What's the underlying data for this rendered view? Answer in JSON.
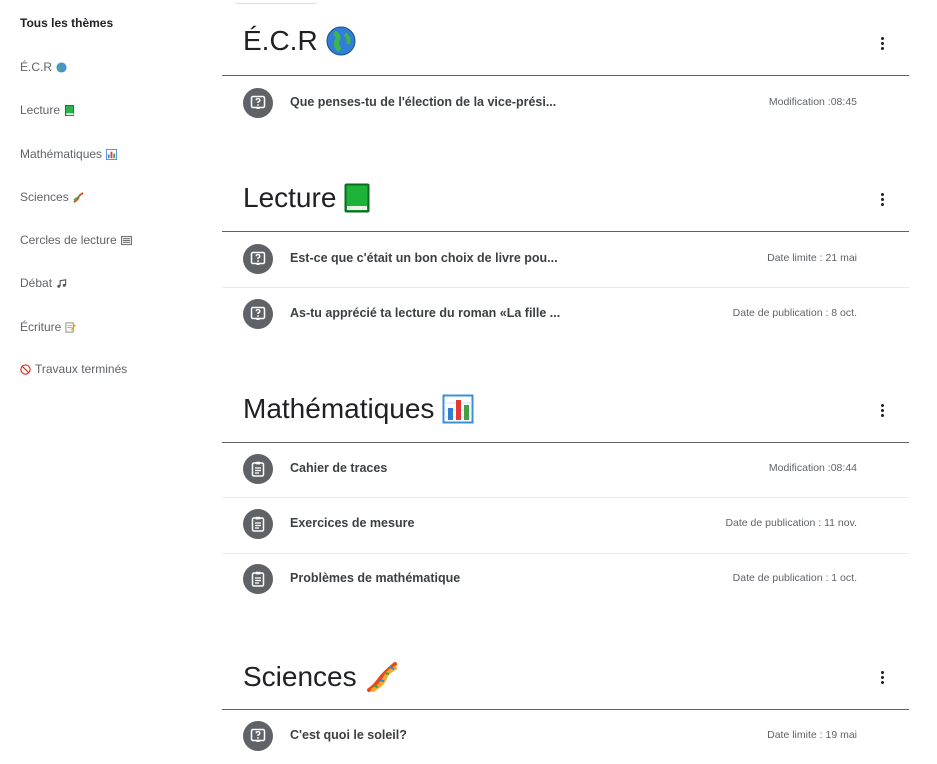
{
  "sidebar": {
    "items": [
      {
        "label": "Tous les thèmes"
      },
      {
        "label": "É.C.R",
        "icon": "globe-icon"
      },
      {
        "label": "Lecture",
        "icon": "green-book-icon"
      },
      {
        "label": "Mathématiques",
        "icon": "bar-chart-icon"
      },
      {
        "label": "Sciences",
        "icon": "dna-icon"
      },
      {
        "label": "Cercles de lecture",
        "icon": "newspaper-icon"
      },
      {
        "label": "Débat",
        "icon": "music-notes-icon"
      },
      {
        "label": "Écriture",
        "icon": "memo-icon"
      },
      {
        "label": "Travaux terminés",
        "icon": "prohibited-icon"
      }
    ]
  },
  "topics": [
    {
      "title": "É.C.R",
      "icon": "globe-icon",
      "items": [
        {
          "type": "question",
          "title": "Que penses-tu de l'élection de la vice-prési...",
          "meta": "Modification :08:45"
        }
      ]
    },
    {
      "title": "Lecture",
      "icon": "green-book-icon",
      "items": [
        {
          "type": "question",
          "title": "Est-ce que c'était un bon choix de livre pou...",
          "meta": "Date limite : 21 mai"
        },
        {
          "type": "question",
          "title": "As-tu apprécié ta lecture du roman «La fille ...",
          "meta": "Date de publication : 8 oct."
        }
      ]
    },
    {
      "title": "Mathématiques",
      "icon": "bar-chart-icon",
      "items": [
        {
          "type": "material",
          "title": "Cahier de traces",
          "meta": "Modification :08:44"
        },
        {
          "type": "material",
          "title": "Exercices de mesure",
          "meta": "Date de publication : 11 nov."
        },
        {
          "type": "material",
          "title": "Problèmes de mathématique",
          "meta": "Date de publication : 1 oct."
        }
      ]
    },
    {
      "title": "Sciences",
      "icon": "dna-icon",
      "items": [
        {
          "type": "question",
          "title": "C'est quoi le soleil?",
          "meta": "Date limite : 19 mai"
        }
      ]
    }
  ],
  "colors": {
    "icon_circle": "#5f6368",
    "divider": "#5f6368",
    "light_divider": "#e8eaed"
  }
}
